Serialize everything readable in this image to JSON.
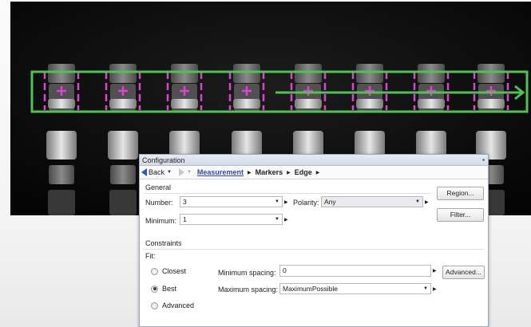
{
  "panel": {
    "title": "Configuration",
    "pin_icon": "pin-icon"
  },
  "nav": {
    "back_label": "Back",
    "breadcrumbs": [
      "Measurement",
      "Markers",
      "Edge"
    ]
  },
  "general": {
    "section_label": "General",
    "number_label": "Number:",
    "number_value": "3",
    "polarity_label": "Polarity:",
    "polarity_value": "Any",
    "minimum_label": "Minimum:",
    "minimum_value": "1",
    "region_button": "Region...",
    "filter_button": "Filter..."
  },
  "constraints": {
    "section_label": "Constraints",
    "fit_label": "Fit:",
    "options": [
      "Closest",
      "Best",
      "Advanced"
    ],
    "selected": "Best",
    "min_spacing_label": "Minimum spacing:",
    "min_spacing_value": "0",
    "max_spacing_label": "Maximum spacing:",
    "max_spacing_value": "MaximumPossible",
    "advanced_button": "Advanced..."
  },
  "colors": {
    "overlay_green": "#4fc34f",
    "marker_magenta": "#e040d8",
    "link_blue": "#2c48a8"
  }
}
